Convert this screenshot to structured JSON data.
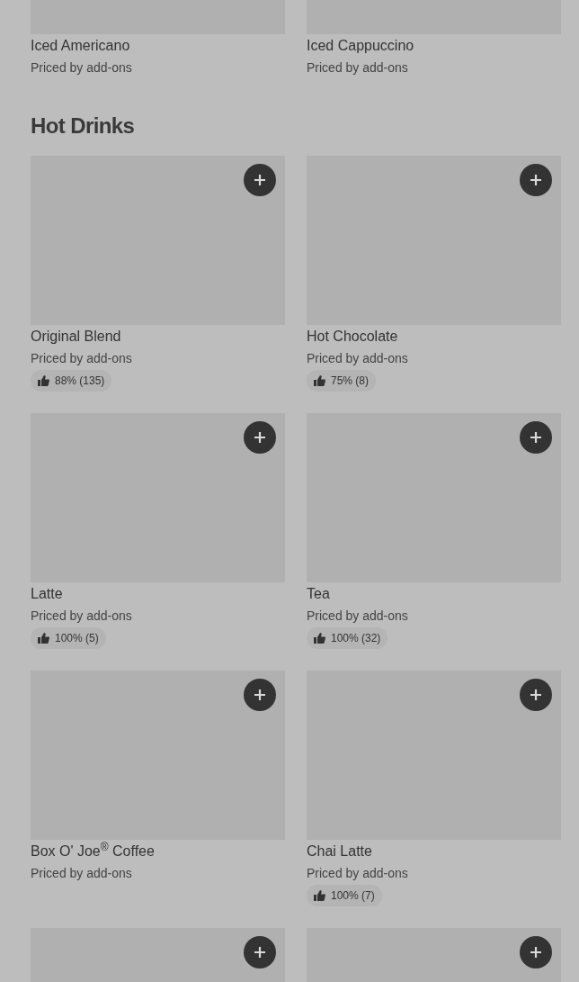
{
  "previous_items": [
    {
      "name": "Iced Americano",
      "price": "Priced by add-ons"
    },
    {
      "name": "Iced Cappuccino",
      "price": "Priced by add-ons"
    }
  ],
  "section": {
    "title": "Hot Drinks",
    "items": [
      {
        "kind": "item",
        "name": "Original Blend",
        "price": "Priced by add-ons",
        "rating": "88% (135)"
      },
      {
        "kind": "item",
        "name": "Hot Chocolate",
        "price": "Priced by add-ons",
        "rating": "75% (8)"
      },
      {
        "kind": "item",
        "name": "Latte",
        "price": "Priced by add-ons",
        "rating": "100% (5)"
      },
      {
        "kind": "item",
        "name": "Tea",
        "price": "Priced by add-ons",
        "rating": "100% (32)"
      },
      {
        "kind": "item",
        "name": "Box O' Joe$^{®}$ Coffee",
        "price": "Priced by add-ons"
      },
      {
        "kind": "item",
        "name": "Chai Latte",
        "price": "Priced by add-ons",
        "rating": "100% (7)"
      },
      {
        "kind": "partial"
      },
      {
        "kind": "partial"
      }
    ]
  }
}
